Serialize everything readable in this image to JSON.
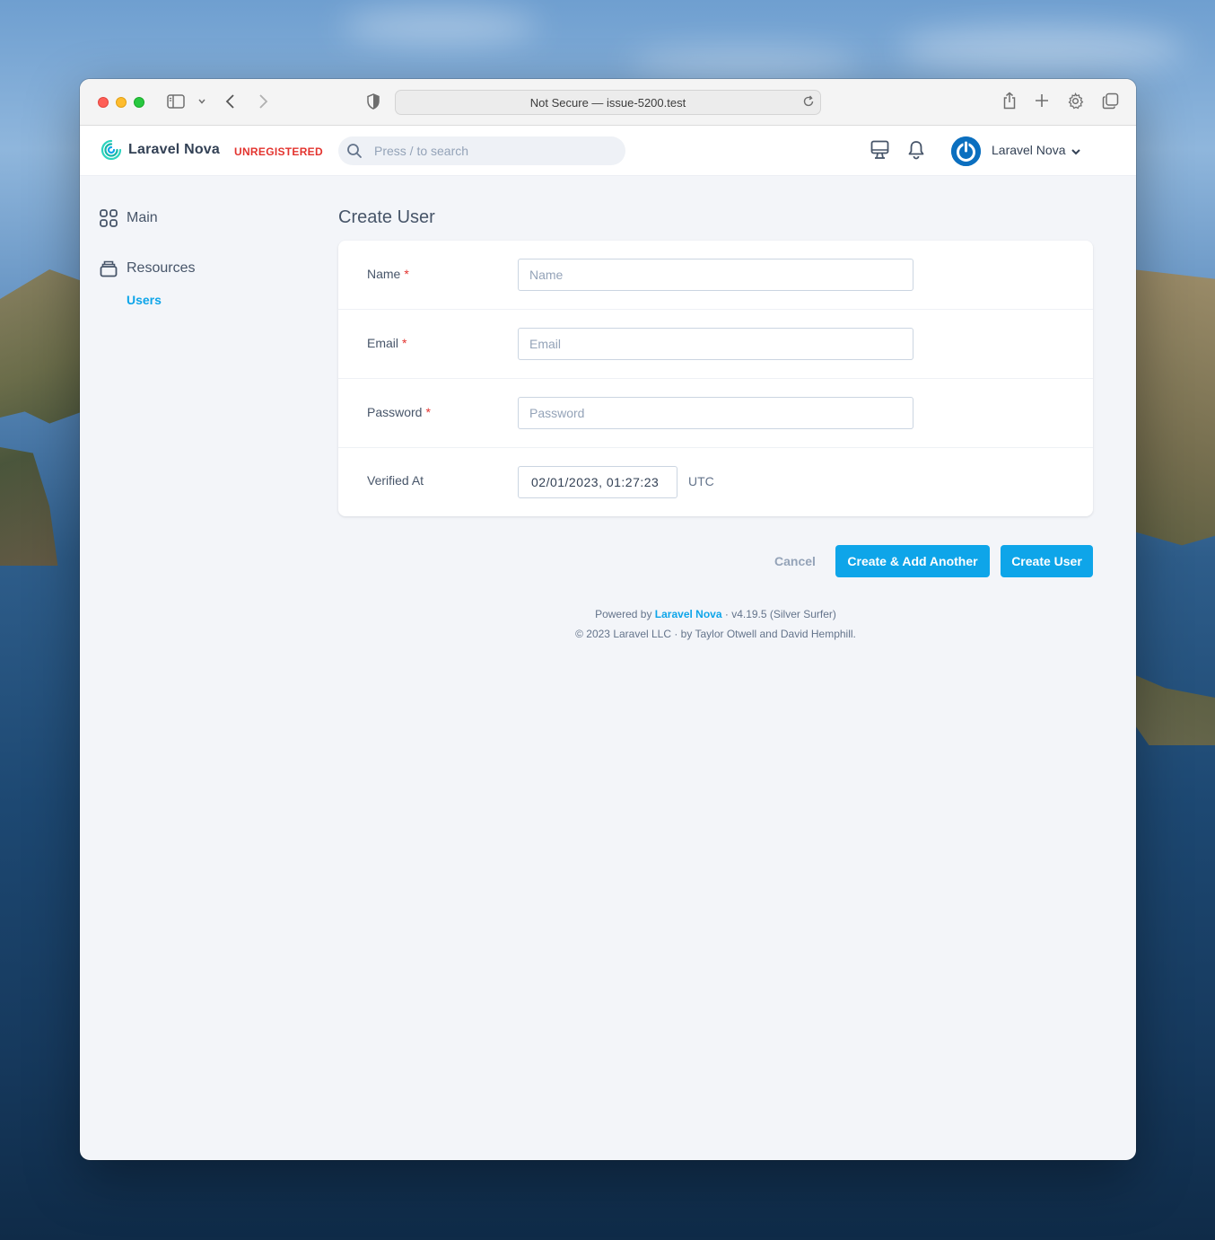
{
  "browser": {
    "url_text": "Not Secure — issue-5200.test"
  },
  "header": {
    "brand": "Laravel Nova",
    "badge": "UNREGISTERED",
    "search_placeholder": "Press / to search",
    "user_name": "Laravel Nova"
  },
  "sidebar": {
    "main_label": "Main",
    "resources_label": "Resources",
    "users_label": "Users"
  },
  "form": {
    "title": "Create User",
    "fields": [
      {
        "label": "Name",
        "required_mark": "*",
        "placeholder": "Name",
        "value": ""
      },
      {
        "label": "Email",
        "required_mark": "*",
        "placeholder": "Email",
        "value": ""
      },
      {
        "label": "Password",
        "required_mark": "*",
        "placeholder": "Password",
        "value": ""
      }
    ],
    "verified": {
      "label": "Verified At",
      "value": "02/01/2023, 01:27:23",
      "timezone": "UTC"
    }
  },
  "actions": {
    "cancel": "Cancel",
    "create_another": "Create & Add Another",
    "create": "Create User"
  },
  "footer": {
    "powered_prefix": "Powered by",
    "powered_link": "Laravel Nova",
    "version": "· v4.19.5 (Silver Surfer)",
    "copyright": "© 2023 Laravel LLC · by Taylor Otwell and David Hemphill."
  },
  "colors": {
    "accent": "#0ea5e9",
    "danger": "#e3342f",
    "background": "#f3f5f9"
  }
}
